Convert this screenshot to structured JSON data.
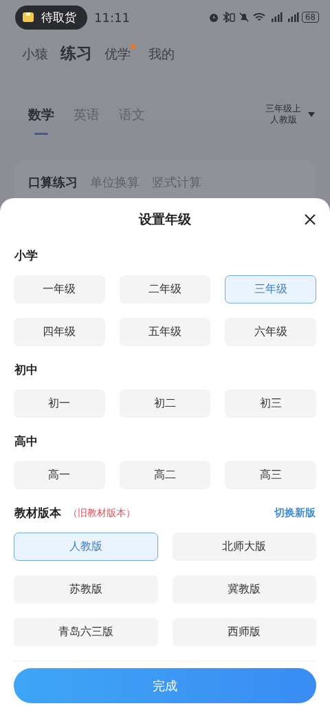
{
  "status_bar": {
    "pill_label": "待取货",
    "time": "11:11",
    "battery": "68"
  },
  "top_nav": [
    {
      "label": "小猿",
      "selected": false,
      "dot": false
    },
    {
      "label": "练习",
      "selected": true,
      "dot": false
    },
    {
      "label": "优学",
      "selected": false,
      "dot": true
    },
    {
      "label": "我的",
      "selected": false,
      "dot": false
    }
  ],
  "subject_tabs": [
    {
      "label": "数学",
      "selected": true
    },
    {
      "label": "英语",
      "selected": false
    },
    {
      "label": "语文",
      "selected": false
    }
  ],
  "grade_selector": {
    "grade": "三年级上",
    "edition": "人教版"
  },
  "practice_tabs": [
    {
      "label": "口算练习",
      "selected": true
    },
    {
      "label": "单位换算",
      "selected": false
    },
    {
      "label": "竖式计算",
      "selected": false
    }
  ],
  "sheet": {
    "title": "设置年级",
    "groups": [
      {
        "heading": "小学",
        "options": [
          {
            "label": "一年级",
            "selected": false
          },
          {
            "label": "二年级",
            "selected": false
          },
          {
            "label": "三年级",
            "selected": true
          },
          {
            "label": "四年级",
            "selected": false
          },
          {
            "label": "五年级",
            "selected": false
          },
          {
            "label": "六年级",
            "selected": false
          }
        ]
      },
      {
        "heading": "初中",
        "options": [
          {
            "label": "初一",
            "selected": false
          },
          {
            "label": "初二",
            "selected": false
          },
          {
            "label": "初三",
            "selected": false
          }
        ]
      },
      {
        "heading": "高中",
        "options": [
          {
            "label": "高一",
            "selected": false
          },
          {
            "label": "高二",
            "selected": false
          },
          {
            "label": "高三",
            "selected": false
          }
        ]
      }
    ],
    "edition_heading": "教材版本",
    "edition_note": "（旧教材版本）",
    "switch_link": "切换新版",
    "editions": [
      {
        "label": "人教版",
        "selected": true
      },
      {
        "label": "北师大版",
        "selected": false
      },
      {
        "label": "苏教版",
        "selected": false
      },
      {
        "label": "冀教版",
        "selected": false
      },
      {
        "label": "青岛六三版",
        "selected": false
      },
      {
        "label": "西师版",
        "selected": false
      }
    ],
    "done_button": "完成"
  }
}
